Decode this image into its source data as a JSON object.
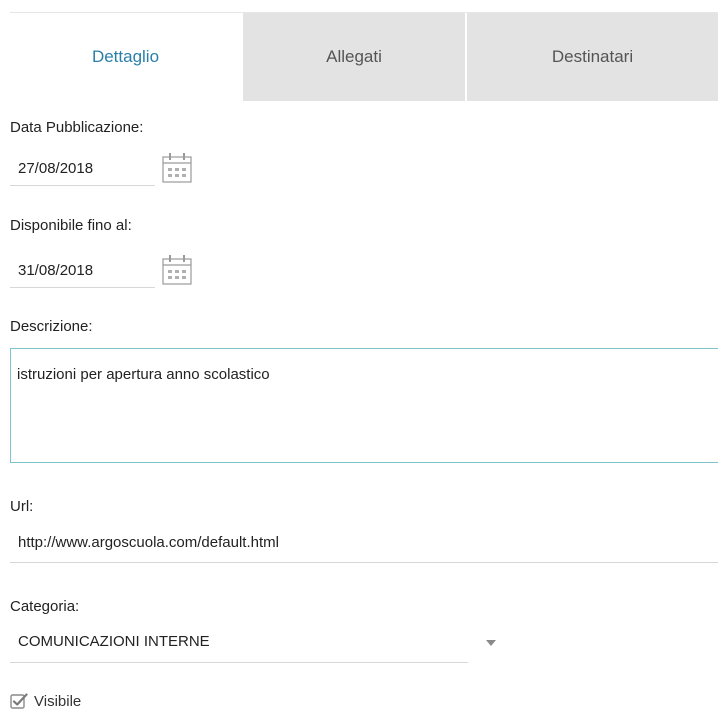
{
  "tabs": [
    {
      "label": "Dettaglio",
      "active": true
    },
    {
      "label": "Allegati",
      "active": false
    },
    {
      "label": "Destinatari",
      "active": false
    }
  ],
  "form": {
    "data_pubblicazione": {
      "label": "Data Pubblicazione:",
      "value": "27/08/2018"
    },
    "disponibile_fino": {
      "label": "Disponibile fino al:",
      "value": "31/08/2018"
    },
    "descrizione": {
      "label": "Descrizione:",
      "value": "istruzioni per apertura anno scolastico"
    },
    "url": {
      "label": "Url:",
      "value": "http://www.argoscuola.com/default.html"
    },
    "categoria": {
      "label": "Categoria:",
      "value": "COMUNICAZIONI INTERNE"
    },
    "visibile": {
      "label": "Visibile",
      "checked": true
    }
  },
  "icons": {
    "calendar": "calendar-icon",
    "dropdown": "chevron-down-icon",
    "checkbox": "checkbox-checked-icon"
  },
  "colors": {
    "accent": "#2a7fa8",
    "tab_inactive_bg": "#e3e3e3",
    "focus_border": "#7fc4c8"
  }
}
